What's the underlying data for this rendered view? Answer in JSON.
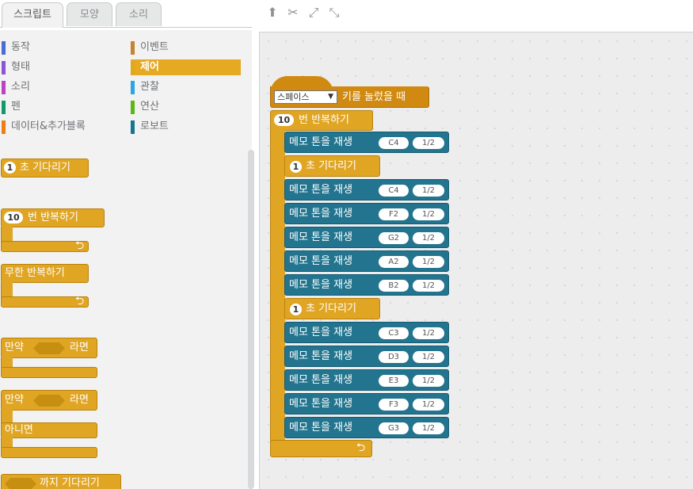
{
  "tabs": [
    "스크립트",
    "모양",
    "소리"
  ],
  "toolbar": {
    "tools": [
      {
        "name": "stamp-icon",
        "glyph": "⬆"
      },
      {
        "name": "cut-icon",
        "glyph": "✂"
      },
      {
        "name": "grow-icon",
        "glyph": "⤢"
      },
      {
        "name": "shrink-icon",
        "glyph": "⤡"
      }
    ]
  },
  "categories": [
    {
      "label": "동작",
      "color": "#4a6cd4"
    },
    {
      "label": "이벤트",
      "color": "#c88330"
    },
    {
      "label": "형태",
      "color": "#8a55d7"
    },
    {
      "label": "제어",
      "color": "#e1a91a"
    },
    {
      "label": "소리",
      "color": "#bb42c3"
    },
    {
      "label": "관찰",
      "color": "#2ca5e2"
    },
    {
      "label": "펜",
      "color": "#0e9a6c"
    },
    {
      "label": "연산",
      "color": "#5cb712"
    },
    {
      "label": "데이터&추가블록",
      "color": "#ee7d16"
    },
    {
      "label": "로보트",
      "color": "#157690"
    }
  ],
  "palette": {
    "wait_secs": "1",
    "wait_label": "초 기다리기",
    "repeat_count": "10",
    "repeat_label": "번 반복하기",
    "forever_label": "무한 반복하기",
    "if_prefix": "만약",
    "if_suffix": "라면",
    "else_label": "아니면",
    "wait_until_label": "까지 기다리기"
  },
  "script": {
    "hat_key": "스페이스",
    "hat_label": "키를 눌렀을 때",
    "repeat_count": "10",
    "repeat_label": "번 반복하기",
    "note_label": "메모 톤을 재생",
    "wait_label": "초 기다리기",
    "items": [
      {
        "kind": "note",
        "note": "C4",
        "dur": "1/2"
      },
      {
        "kind": "wait",
        "secs": "1"
      },
      {
        "kind": "note",
        "note": "C4",
        "dur": "1/2"
      },
      {
        "kind": "note",
        "note": "F2",
        "dur": "1/2"
      },
      {
        "kind": "note",
        "note": "G2",
        "dur": "1/2"
      },
      {
        "kind": "note",
        "note": "A2",
        "dur": "1/2"
      },
      {
        "kind": "note",
        "note": "B2",
        "dur": "1/2"
      },
      {
        "kind": "wait",
        "secs": "1"
      },
      {
        "kind": "note",
        "note": "C3",
        "dur": "1/2"
      },
      {
        "kind": "note",
        "note": "D3",
        "dur": "1/2"
      },
      {
        "kind": "note",
        "note": "E3",
        "dur": "1/2"
      },
      {
        "kind": "note",
        "note": "F3",
        "dur": "1/2"
      },
      {
        "kind": "note",
        "note": "G3",
        "dur": "1/2"
      }
    ]
  }
}
